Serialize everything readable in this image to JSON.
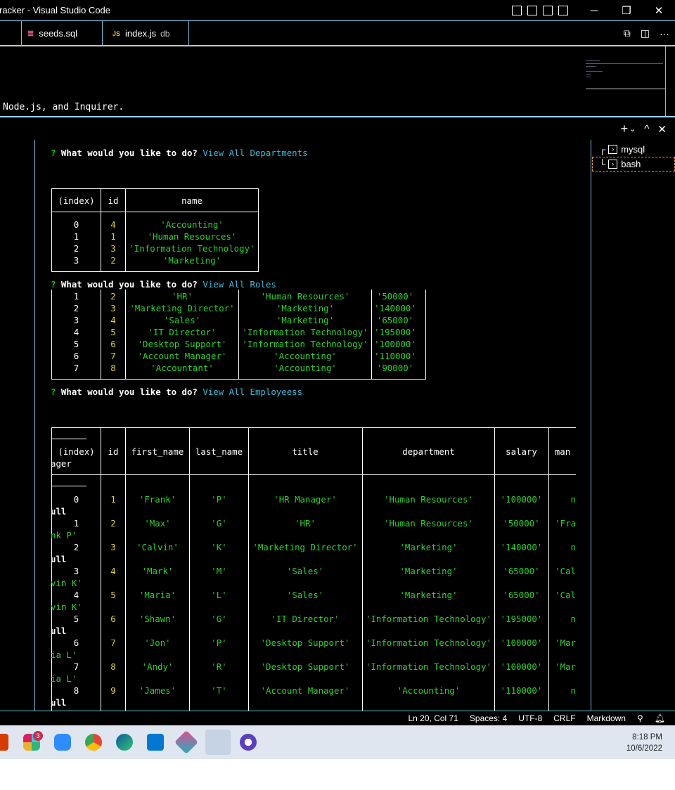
{
  "window": {
    "title": "racker - Visual Studio Code",
    "minimize": "─",
    "restore": "❐",
    "close": "✕"
  },
  "tabs": [
    {
      "label": "seeds.sql",
      "icon": "database-icon",
      "desc": ""
    },
    {
      "label": "index.js",
      "icon": "js-icon",
      "desc": "db"
    }
  ],
  "editor": {
    "visible_line": "Node.js, and Inquirer."
  },
  "panel": {
    "add": "+",
    "dropdown": "⌄",
    "maximize": "^",
    "close": "✕"
  },
  "terminals": [
    {
      "label": "mysql",
      "prefix": "┌"
    },
    {
      "label": "bash",
      "prefix": "└"
    }
  ],
  "terminal": {
    "prompts": [
      {
        "question": "What would you like to do?",
        "answer": "View All Departments"
      },
      {
        "question": "What would you like to do?",
        "answer": "View All Roles"
      },
      {
        "question": "What would you like to do?",
        "answer": "View All Employeess"
      }
    ],
    "departments": {
      "headers": [
        "(index)",
        "id",
        "name"
      ],
      "rows": [
        [
          "0",
          "4",
          "'Accounting'"
        ],
        [
          "1",
          "1",
          "'Human Resources'"
        ],
        [
          "2",
          "3",
          "'Information Technology'"
        ],
        [
          "3",
          "2",
          "'Marketing'"
        ]
      ]
    },
    "roles": {
      "rows": [
        [
          "1",
          "2",
          "'HR'",
          "'Human Resources'",
          "'50000'"
        ],
        [
          "2",
          "3",
          "'Marketing Director'",
          "'Marketing'",
          "'140000'"
        ],
        [
          "3",
          "4",
          "'Sales'",
          "'Marketing'",
          "'65000'"
        ],
        [
          "4",
          "5",
          "'IT Director'",
          "'Information Technology'",
          "'195000'"
        ],
        [
          "5",
          "6",
          "'Desktop Support'",
          "'Information Technology'",
          "'100000'"
        ],
        [
          "6",
          "7",
          "'Account Manager'",
          "'Accounting'",
          "'110000'"
        ],
        [
          "7",
          "8",
          "'Accountant'",
          "'Accounting'",
          "'90000'"
        ]
      ]
    },
    "employees": {
      "headers": [
        "(index)",
        "id",
        "first_name",
        "last_name",
        "title",
        "department",
        "salary",
        "man"
      ],
      "header_wrap": "ager",
      "rows": [
        {
          "c": [
            "0",
            "1",
            "'Frank'",
            "'P'",
            "'HR Manager'",
            "'Human Resources'",
            "'100000'",
            "n"
          ],
          "wrap": "ull"
        },
        {
          "c": [
            "1",
            "2",
            "'Max'",
            "'G'",
            "'HR'",
            "'Human Resources'",
            "'50000'",
            "'Fra"
          ],
          "wrap": "nk P'"
        },
        {
          "c": [
            "2",
            "3",
            "'Calvin'",
            "'K'",
            "'Marketing Director'",
            "'Marketing'",
            "'140000'",
            "n"
          ],
          "wrap": "ull"
        },
        {
          "c": [
            "3",
            "4",
            "'Mark'",
            "'M'",
            "'Sales'",
            "'Marketing'",
            "'65000'",
            "'Cal"
          ],
          "wrap": "vin K'"
        },
        {
          "c": [
            "4",
            "5",
            "'Maria'",
            "'L'",
            "'Sales'",
            "'Marketing'",
            "'65000'",
            "'Cal"
          ],
          "wrap": "vin K'"
        },
        {
          "c": [
            "5",
            "6",
            "'Shawn'",
            "'G'",
            "'IT Director'",
            "'Information Technology'",
            "'195000'",
            "n"
          ],
          "wrap": "ull"
        },
        {
          "c": [
            "6",
            "7",
            "'Jon'",
            "'P'",
            "'Desktop Support'",
            "'Information Technology'",
            "'100000'",
            "'Mar"
          ],
          "wrap": "ia L'"
        },
        {
          "c": [
            "7",
            "8",
            "'Andy'",
            "'R'",
            "'Desktop Support'",
            "'Information Technology'",
            "'100000'",
            "'Mar"
          ],
          "wrap": "ia L'"
        },
        {
          "c": [
            "8",
            "9",
            "'James'",
            "'T'",
            "'Account Manager'",
            "'Accounting'",
            "'110000'",
            "n"
          ],
          "wrap": "ull"
        }
      ]
    }
  },
  "status": {
    "position": "Ln 20, Col 71",
    "spaces": "Spaces: 4",
    "encoding": "UTF-8",
    "eol": "CRLF",
    "language": "Markdown"
  },
  "taskbar": {
    "time": "8:18 PM",
    "date": "10/6/2022",
    "badge": "3",
    "apps": [
      "office-icon",
      "slack-icon",
      "zoom-icon",
      "chrome-icon",
      "edge-icon",
      "vscode-icon",
      "gitkraken-icon",
      "snipping-tool-icon",
      "screen-recorder-icon"
    ]
  },
  "colors": {
    "border": "#6fc3df",
    "string": "#2bd12b",
    "number": "#e0d028",
    "answer": "#3db8d8"
  }
}
